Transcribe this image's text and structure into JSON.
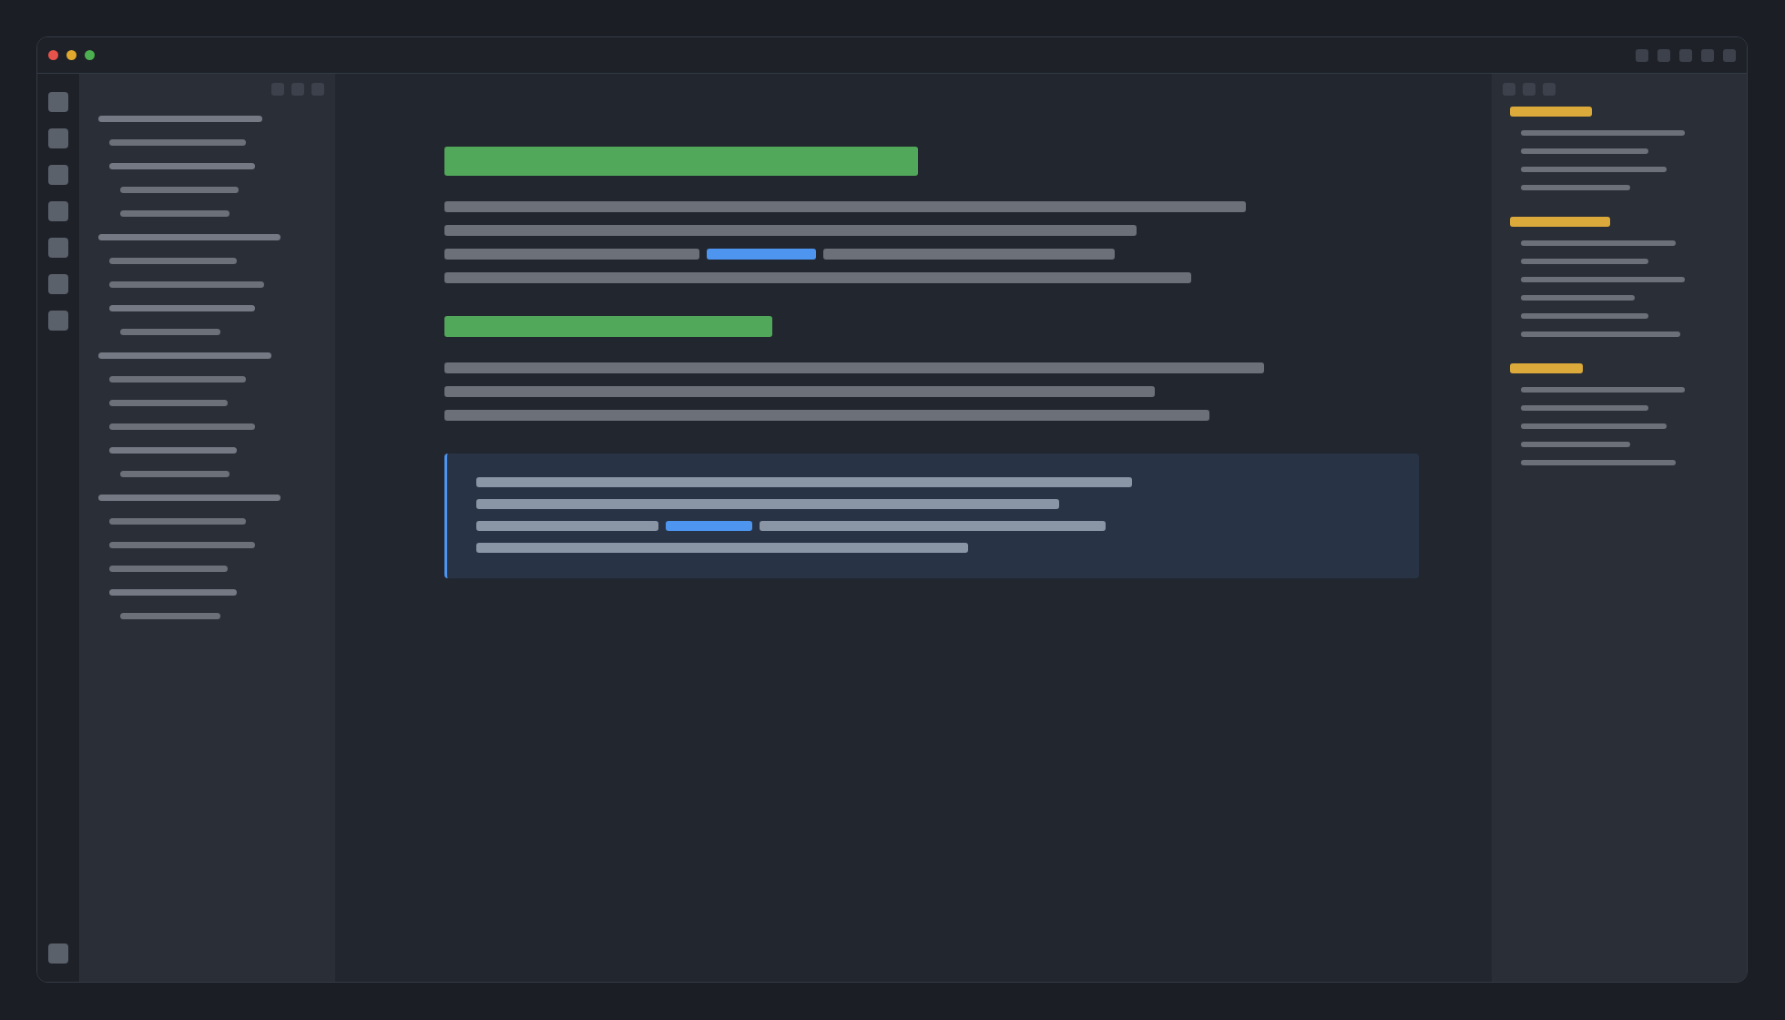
{
  "window": {
    "traffic_lights": [
      {
        "color": "#e5534b"
      },
      {
        "color": "#e0a92e"
      },
      {
        "color": "#4caf50"
      }
    ]
  },
  "file_tree": [
    {
      "kind": "folder",
      "children": [
        {
          "kind": "file"
        },
        {
          "kind": "folder",
          "children": [
            {
              "kind": "file"
            },
            {
              "kind": "file"
            }
          ]
        }
      ]
    },
    {
      "kind": "folder",
      "children": [
        {
          "kind": "file"
        },
        {
          "kind": "file"
        },
        {
          "kind": "folder",
          "children": [
            {
              "kind": "file"
            }
          ]
        }
      ]
    },
    {
      "kind": "folder",
      "children": [
        {
          "kind": "file"
        },
        {
          "kind": "file"
        },
        {
          "kind": "file"
        },
        {
          "kind": "folder",
          "children": [
            {
              "kind": "file"
            }
          ]
        }
      ]
    },
    {
      "kind": "folder",
      "children": [
        {
          "kind": "file"
        },
        {
          "kind": "file"
        },
        {
          "kind": "file"
        },
        {
          "kind": "folder",
          "children": [
            {
              "kind": "file"
            }
          ]
        }
      ]
    }
  ],
  "document": {
    "blocks": [
      {
        "kind": "heading"
      },
      {
        "kind": "line",
        "link": false
      },
      {
        "kind": "line",
        "link": false
      },
      {
        "kind": "line",
        "link": true
      },
      {
        "kind": "line",
        "link": false
      },
      {
        "kind": "heading"
      },
      {
        "kind": "line",
        "link": false
      },
      {
        "kind": "line",
        "link": false
      },
      {
        "kind": "line",
        "link": false
      },
      {
        "kind": "callout",
        "lines": [
          {
            "link": false
          },
          {
            "link": false
          },
          {
            "link": true
          },
          {
            "link": false
          }
        ]
      }
    ]
  },
  "outline": {
    "sections": [
      {
        "items": [
          {
            "kind": "entry"
          },
          {
            "kind": "entry"
          },
          {
            "kind": "entry"
          },
          {
            "kind": "entry"
          }
        ]
      },
      {
        "items": [
          {
            "kind": "entry"
          },
          {
            "kind": "entry"
          },
          {
            "kind": "entry"
          },
          {
            "kind": "entry"
          },
          {
            "kind": "entry"
          },
          {
            "kind": "entry"
          }
        ]
      },
      {
        "items": [
          {
            "kind": "entry"
          },
          {
            "kind": "entry"
          },
          {
            "kind": "entry"
          },
          {
            "kind": "entry"
          },
          {
            "kind": "entry"
          }
        ]
      }
    ]
  }
}
